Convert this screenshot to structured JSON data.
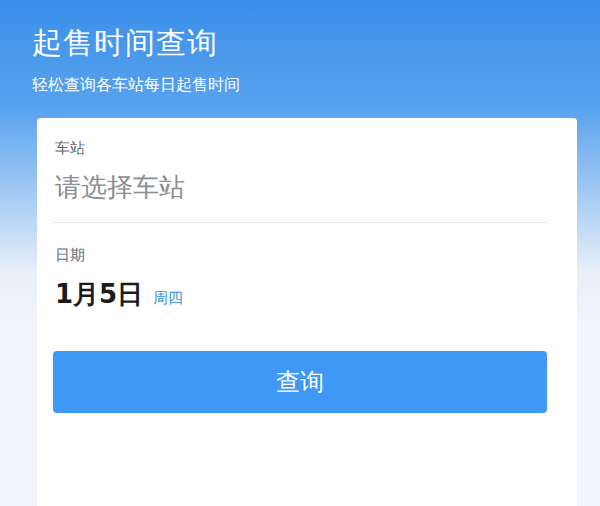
{
  "header": {
    "title": "起售时间查询",
    "subtitle": "轻松查询各车站每日起售时间"
  },
  "form": {
    "fields": [
      {
        "label": "车站",
        "value": "请选择车站",
        "kind": "placeholder"
      },
      {
        "label": "日期",
        "value": "1月5日",
        "weekday": "周四",
        "kind": "date"
      }
    ],
    "button": "查询"
  }
}
